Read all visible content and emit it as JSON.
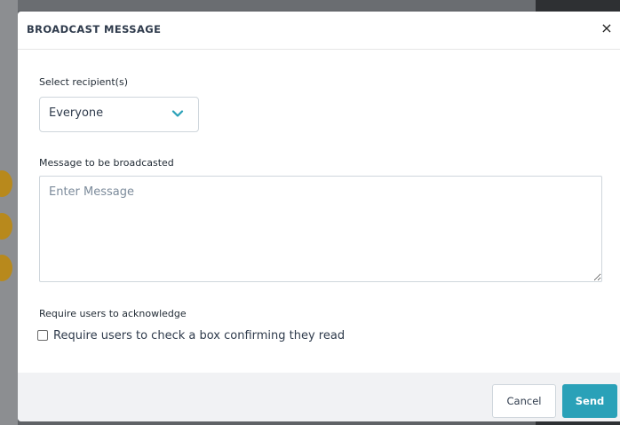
{
  "dialog": {
    "title": "BROADCAST MESSAGE",
    "close_symbol": "×"
  },
  "recipients": {
    "label": "Select recipient(s)",
    "selected": "Everyone",
    "dropdown_icon": "chevron-down-icon"
  },
  "message": {
    "label": "Message to be broadcasted",
    "placeholder": "Enter Message",
    "value": ""
  },
  "acknowledge": {
    "label": "Require users to acknowledge",
    "checkbox_label": "Require users to check a box confirming they read",
    "checked": false
  },
  "footer": {
    "cancel_label": "Cancel",
    "send_label": "Send"
  },
  "colors": {
    "accent": "#2aa1b8",
    "title_text": "#2f3b4c",
    "footer_bg": "#f1f2f4",
    "placeholder_text": "#7c8b9b"
  }
}
